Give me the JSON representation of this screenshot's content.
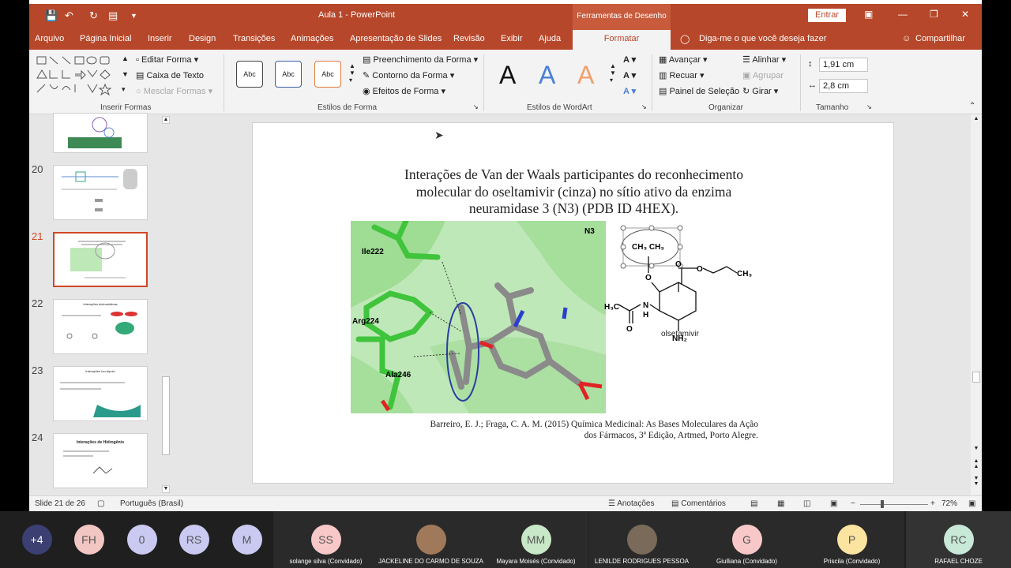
{
  "window": {
    "app_title": "Aula 1  -  PowerPoint",
    "contextual_tab": "Ferramentas de Desenho",
    "signin": "Entrar"
  },
  "tabs": [
    "Arquivo",
    "Página Inicial",
    "Inserir",
    "Design",
    "Transições",
    "Animações",
    "Apresentação de Slides",
    "Revisão",
    "Exibir",
    "Ajuda"
  ],
  "active_tab": "Formatar",
  "tell_me": "Diga-me o que você deseja fazer",
  "share": "Compartilhar",
  "ribbon": {
    "insert_shapes": {
      "label": "Inserir Formas",
      "edit_shape": "Editar Forma",
      "text_box": "Caixa de Texto",
      "merge_shapes": "Mesclar Formas"
    },
    "shape_styles": {
      "label": "Estilos de Forma",
      "sample": "Abc",
      "fill": "Preenchimento da Forma",
      "outline": "Contorno da Forma",
      "effects": "Efeitos de Forma"
    },
    "wordart": {
      "label": "Estilos de WordArt",
      "letter": "A"
    },
    "arrange": {
      "label": "Organizar",
      "bring_forward": "Avançar",
      "send_backward": "Recuar",
      "selection_pane": "Painel de Seleção",
      "align": "Alinhar",
      "group": "Agrupar",
      "rotate": "Girar"
    },
    "size": {
      "label": "Tamanho",
      "height": "1,91 cm",
      "width": "2,8 cm"
    }
  },
  "thumbnails": [
    {
      "num": "",
      "selected": false
    },
    {
      "num": "20",
      "selected": false
    },
    {
      "num": "21",
      "selected": true
    },
    {
      "num": "22",
      "selected": false,
      "caption": "Interações eletrostáticas"
    },
    {
      "num": "23",
      "selected": false,
      "caption": "Interações Ion-dipolo"
    },
    {
      "num": "24",
      "selected": false,
      "caption": "Interações de Hidrogênio"
    }
  ],
  "slide": {
    "title_lines": [
      "Interações de Van der Waals participantes do reconhecimento",
      "molecular do oseltamivir (cinza) no sítio ativo da enzima",
      "neuramidase 3 (N3) (PDB ID 4HEX)."
    ],
    "labels": {
      "n3": "N3",
      "ile": "Ile222",
      "arg": "Arg224",
      "ala": "Ala246"
    },
    "structure": {
      "ch3_pair": "CH₃   CH₃",
      "o_top": "O",
      "o_ester1": "O",
      "o_ester2": "O",
      "ch3_right": "CH₃",
      "h3c": "H₃C",
      "o_amide": "O",
      "nh": "N",
      "h": "H",
      "nh2": "NH₂",
      "o_ring": "O",
      "name": "olsetamivir"
    },
    "reference_lines": [
      "Barreiro, E. J.; Fraga, C. A. M. (2015) Química Medicinal: As Bases Moleculares da Ação",
      "dos Fármacos, 3ª Edição, Artmed, Porto Alegre."
    ]
  },
  "status": {
    "slide_info": "Slide 21 de 26",
    "language": "Português (Brasil)",
    "notes": "Anotações",
    "comments": "Comentários",
    "zoom": "72%"
  },
  "participants": [
    {
      "initials": "+4",
      "name": "",
      "color": "#3b3f72"
    },
    {
      "initials": "FH",
      "name": "",
      "color": "#f2c6c2"
    },
    {
      "initials": "0",
      "name": "",
      "color": "#c9c9f2"
    },
    {
      "initials": "RS",
      "name": "",
      "color": "#c9c9f2"
    },
    {
      "initials": "M",
      "name": "",
      "color": "#c9c9f2"
    },
    {
      "initials": "SS",
      "name": "solange silva (Convidado)",
      "color": "#f8c8c8"
    },
    {
      "initials": "",
      "name": "JACKELINE DO CARMO DE SOUZA",
      "color": "#a0785a"
    },
    {
      "initials": "MM",
      "name": "Mayara Moisés (Convidado)",
      "color": "#c8e8c8"
    },
    {
      "initials": "",
      "name": "LENILDE RODRIGUES PESSOA",
      "color": "#7a6a5a"
    },
    {
      "initials": "G",
      "name": "Giulliana (Convidado)",
      "color": "#f8c8c8"
    },
    {
      "initials": "P",
      "name": "Priscila (Convidado)",
      "color": "#fbe3a0"
    },
    {
      "initials": "RC",
      "name": "RAFAEL CHOZE",
      "color": "#c8e8d8"
    }
  ]
}
